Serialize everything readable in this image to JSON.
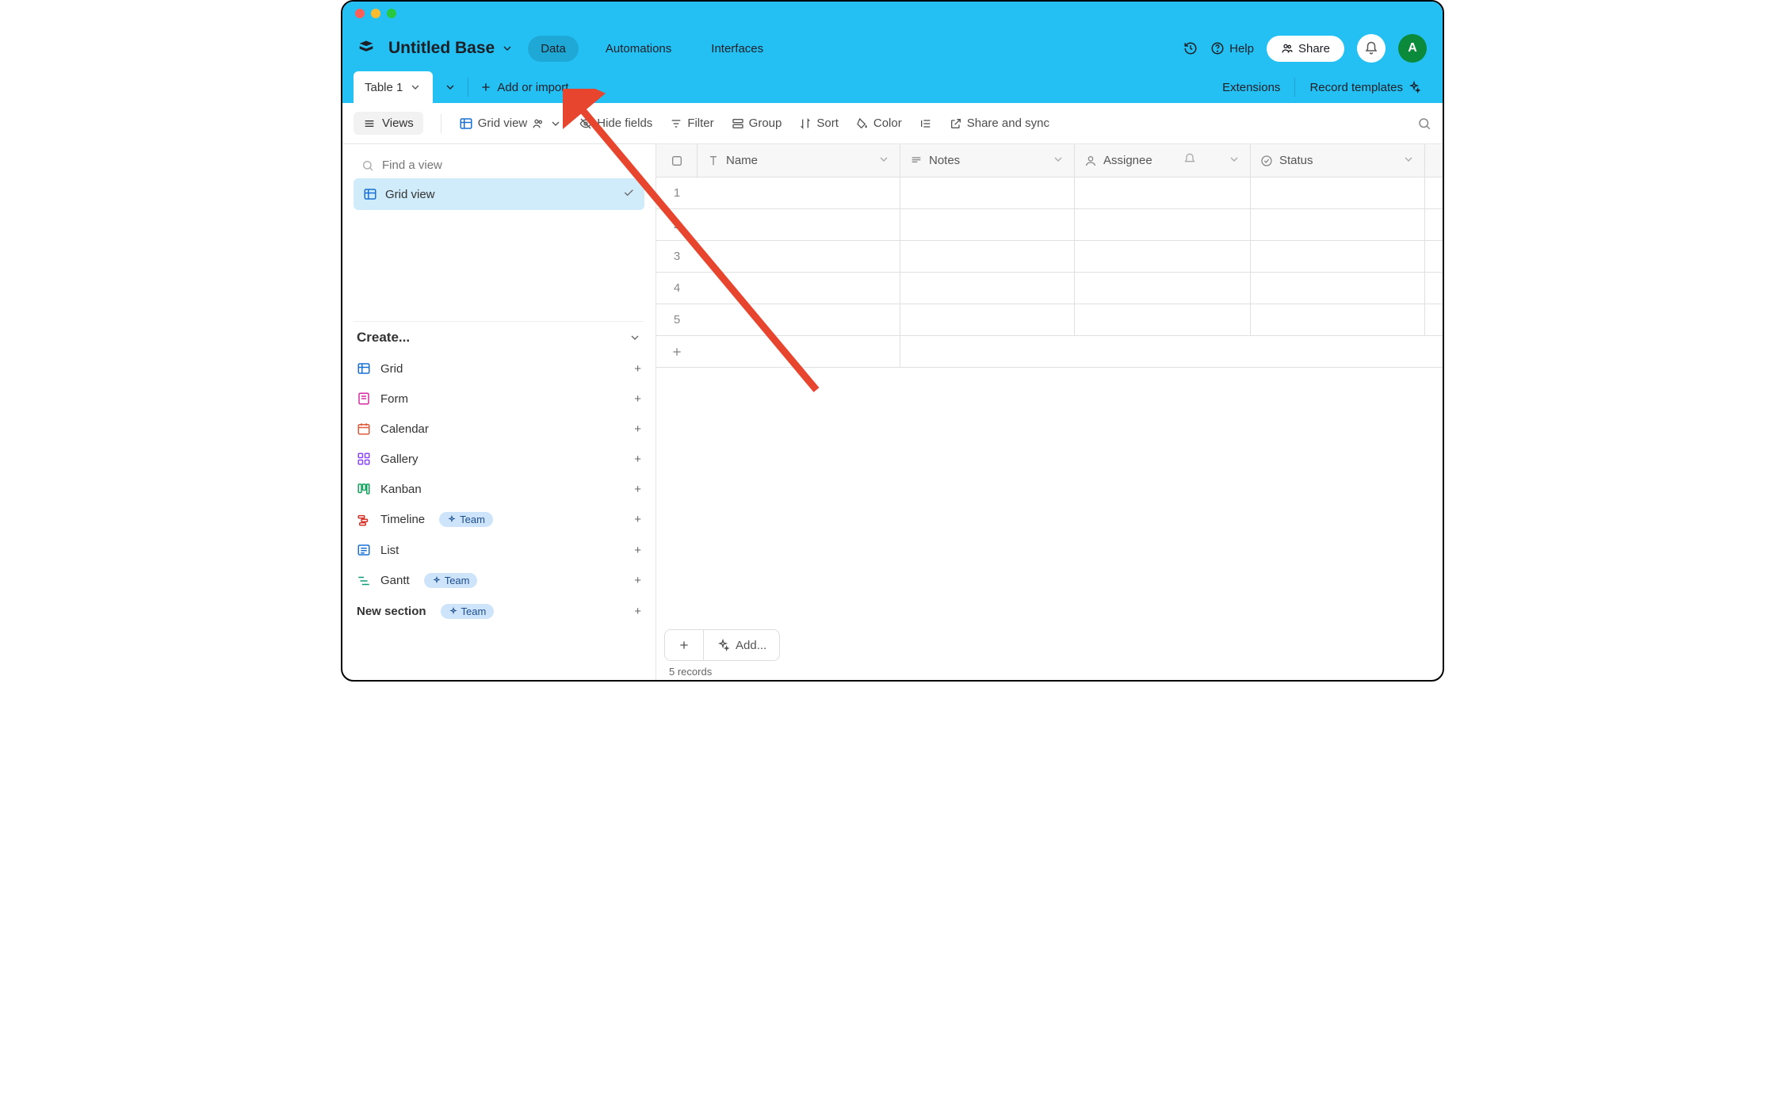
{
  "base": {
    "title": "Untitled Base"
  },
  "nav": {
    "data": "Data",
    "automations": "Automations",
    "interfaces": "Interfaces"
  },
  "header": {
    "help": "Help",
    "share": "Share",
    "avatar": "A"
  },
  "tabbar": {
    "table1": "Table 1",
    "add_or_import": "Add or import",
    "extensions": "Extensions",
    "record_templates": "Record templates"
  },
  "toolbar": {
    "views": "Views",
    "grid_view": "Grid view",
    "hide_fields": "Hide fields",
    "filter": "Filter",
    "group": "Group",
    "sort": "Sort",
    "color": "Color",
    "share_sync": "Share and sync"
  },
  "sidebar": {
    "find_placeholder": "Find a view",
    "grid_view": "Grid view",
    "create": "Create...",
    "items": {
      "grid": "Grid",
      "form": "Form",
      "calendar": "Calendar",
      "gallery": "Gallery",
      "kanban": "Kanban",
      "timeline": "Timeline",
      "list": "List",
      "gantt": "Gantt",
      "new_section": "New section"
    },
    "team_badge": "Team"
  },
  "columns": {
    "name": "Name",
    "notes": "Notes",
    "assignee": "Assignee",
    "status": "Status"
  },
  "rows": [
    "1",
    "2",
    "3",
    "4",
    "5"
  ],
  "footer": {
    "add": "Add...",
    "records": "5 records"
  }
}
